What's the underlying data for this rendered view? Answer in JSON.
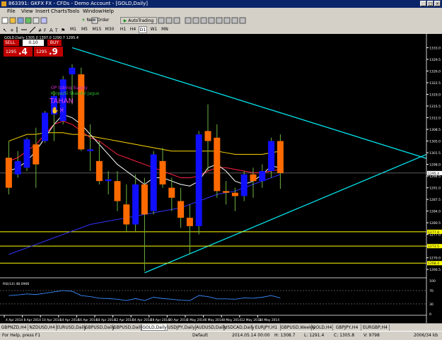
{
  "window": {
    "title": "863391: GKFX FX - CFDs - Demo Account - [GOLD,Daily]"
  },
  "menu": [
    "File",
    "View",
    "Insert",
    "Charts",
    "Tools",
    "Window",
    "Help"
  ],
  "toolbar": {
    "new_order": "New Order",
    "autotrading": "AutoTrading",
    "timeframes": [
      "M1",
      "M5",
      "M15",
      "M30",
      "H1",
      "H4",
      "D1",
      "W1",
      "MN"
    ]
  },
  "chart": {
    "header": "GOLD,Daily  1305.0 1307.0 1290.7 1295.4",
    "trade_panel": {
      "sell_label": "SELL",
      "buy_label": "BUY",
      "lot": "0.10",
      "sell_price_small": "1295",
      "sell_price_big": ".4",
      "buy_price_small": "1295",
      "buy_price_big": ".9"
    },
    "annotation": {
      "line1": "OP tubing Supply",
      "line2": "Ko/pa/Si Skandal Jagus",
      "name": "TAHAN",
      "glyph": "✋♓"
    },
    "price_scale": [
      "1333.0",
      "1329.5",
      "1326.0",
      "1322.5",
      "1319.0",
      "1315.5",
      "1312.0",
      "1308.5",
      "1305.0",
      "1301.5",
      "1298.0",
      "1294.5",
      "1291.0",
      "1287.5",
      "1284.0",
      "1280.5",
      "1277.0",
      "1273.5",
      "1270.0",
      "1266.5"
    ],
    "price_tags": [
      {
        "label": "1295.4",
        "color": "#ffffff",
        "text_color": "#000000"
      },
      {
        "label": "1277.8",
        "color": "#ffff00",
        "text_color": "#000000"
      },
      {
        "label": "1273.5",
        "color": "#ffff00",
        "text_color": "#000000"
      },
      {
        "label": "1268.4",
        "color": "#ffff00",
        "text_color": "#000000"
      }
    ],
    "date_axis": [
      "4 Apr 2014",
      "8 Apr 2014",
      "10 Apr 2014",
      "14 Apr 2014",
      "16 Apr 2014",
      "18 Apr 2014",
      "22 Apr 2014",
      "24 Apr 2014",
      "28 Apr 2014",
      "30 Apr 2014",
      "2 May 2014",
      "6 May 2014",
      "8 May 2014",
      "12 May 2014",
      "14 May 2014"
    ],
    "rsi_label": "RSI(14) 48.0906",
    "rsi_scale": [
      "100",
      "70",
      "30",
      "0"
    ],
    "colors": {
      "bull": "#1010ff",
      "bear": "#ff6a00",
      "wick": "#6db33f",
      "trend": "#00e5ee",
      "ma_red": "#ff2040",
      "ma_yellow": "#ffd700",
      "ma_white": "#ffffff",
      "ma_blue": "#3333ff",
      "level": "#ffff00"
    }
  },
  "chart_data": {
    "type": "candlestick",
    "symbol": "GOLD",
    "timeframe": "Daily",
    "candles": [
      {
        "o": 1300.0,
        "h": 1305.0,
        "l": 1289.0,
        "c": 1291.0
      },
      {
        "o": 1295.0,
        "h": 1302.0,
        "l": 1294.0,
        "c": 1299.0
      },
      {
        "o": 1297.0,
        "h": 1306.0,
        "l": 1296.0,
        "c": 1305.5
      },
      {
        "o": 1304.0,
        "h": 1309.0,
        "l": 1291.0,
        "c": 1298.0
      },
      {
        "o": 1305.0,
        "h": 1314.0,
        "l": 1304.5,
        "c": 1313.5
      },
      {
        "o": 1313.0,
        "h": 1320.0,
        "l": 1305.0,
        "c": 1318.5
      },
      {
        "o": 1311.0,
        "h": 1324.5,
        "l": 1310.0,
        "c": 1323.5
      },
      {
        "o": 1325.0,
        "h": 1328.0,
        "l": 1316.0,
        "c": 1327.0
      },
      {
        "o": 1325.0,
        "h": 1327.0,
        "l": 1302.0,
        "c": 1302.5
      },
      {
        "o": 1302.0,
        "h": 1310.0,
        "l": 1296.0,
        "c": 1302.5
      },
      {
        "o": 1299.0,
        "h": 1305.0,
        "l": 1292.0,
        "c": 1293.0
      },
      {
        "o": 1293.0,
        "h": 1296.0,
        "l": 1289.0,
        "c": 1293.5
      },
      {
        "o": 1293.0,
        "h": 1296.0,
        "l": 1284.0,
        "c": 1287.0
      },
      {
        "o": 1286.0,
        "h": 1292.0,
        "l": 1278.0,
        "c": 1280.0
      },
      {
        "o": 1280.0,
        "h": 1295.0,
        "l": 1278.0,
        "c": 1292.0
      },
      {
        "o": 1292.0,
        "h": 1294.0,
        "l": 1266.0,
        "c": 1283.0
      },
      {
        "o": 1284.0,
        "h": 1302.0,
        "l": 1283.0,
        "c": 1301.0
      },
      {
        "o": 1299.0,
        "h": 1303.0,
        "l": 1291.0,
        "c": 1292.0
      },
      {
        "o": 1291.0,
        "h": 1294.0,
        "l": 1284.0,
        "c": 1288.0
      },
      {
        "o": 1287.0,
        "h": 1291.0,
        "l": 1279.0,
        "c": 1282.0
      },
      {
        "o": 1282.0,
        "h": 1286.0,
        "l": 1271.0,
        "c": 1279.5
      },
      {
        "o": 1279.5,
        "h": 1308.0,
        "l": 1277.0,
        "c": 1307.0
      },
      {
        "o": 1308.0,
        "h": 1316.0,
        "l": 1296.0,
        "c": 1305.0
      },
      {
        "o": 1306.0,
        "h": 1310.0,
        "l": 1288.0,
        "c": 1290.0
      },
      {
        "o": 1290.0,
        "h": 1293.0,
        "l": 1286.0,
        "c": 1289.5
      },
      {
        "o": 1289.5,
        "h": 1291.0,
        "l": 1284.0,
        "c": 1288.5
      },
      {
        "o": 1288.5,
        "h": 1296.0,
        "l": 1287.0,
        "c": 1295.0
      },
      {
        "o": 1295.0,
        "h": 1297.0,
        "l": 1288.0,
        "c": 1293.0
      },
      {
        "o": 1293.0,
        "h": 1298.0,
        "l": 1291.0,
        "c": 1296.0
      },
      {
        "o": 1296.0,
        "h": 1306.0,
        "l": 1294.0,
        "c": 1305.0
      },
      {
        "o": 1305.0,
        "h": 1307.0,
        "l": 1290.7,
        "c": 1295.4
      }
    ],
    "ma_red": [
      1299,
      1300,
      1302,
      1304,
      1307,
      1310,
      1311,
      1310,
      1308,
      1306,
      1305,
      1303,
      1301,
      1300,
      1299,
      1298,
      1297,
      1296,
      1295,
      1294,
      1294,
      1294.5,
      1296,
      1297,
      1297,
      1296.5,
      1296,
      1295.5,
      1295.5,
      1296,
      1296.5
    ],
    "ma_yellow": [
      1305,
      1306,
      1307,
      1307,
      1307.5,
      1307.5,
      1307.5,
      1307,
      1307,
      1306.5,
      1306,
      1305.5,
      1305,
      1304.5,
      1304,
      1303.5,
      1303,
      1302.5,
      1302,
      1302,
      1302,
      1302,
      1302,
      1302,
      1301.5,
      1301,
      1301,
      1301,
      1301,
      1301.5,
      1302
    ],
    "ma_white": [
      1296,
      1297,
      1299,
      1302,
      1306,
      1310,
      1313,
      1312,
      1310,
      1307,
      1304,
      1301,
      1298,
      1296,
      1294,
      1292,
      1294,
      1294,
      1293,
      1292,
      1291.5,
      1293,
      1297,
      1298,
      1296,
      1293,
      1292,
      1293,
      1295,
      1297.5,
      1297
    ],
    "ma_blue": [
      1271,
      1272,
      1273,
      1274,
      1275,
      1276,
      1277,
      1278,
      1279,
      1280,
      1280.5,
      1281,
      1281.5,
      1282,
      1282.5,
      1283,
      1283.5,
      1284,
      1284.5,
      1285,
      1286,
      1287,
      1288,
      1289,
      1289.5,
      1290,
      1291,
      1292,
      1293,
      1294,
      1295
    ],
    "trend_upper": [
      {
        "i": 7,
        "p": 1333.0
      },
      {
        "i": 40,
        "p": 1305.0
      }
    ],
    "trend_lower": [
      {
        "i": 15,
        "p": 1265.5
      },
      {
        "i": 40,
        "p": 1294.0
      }
    ],
    "levels": [
      1277.8,
      1273.5,
      1268.4
    ],
    "current_price": 1295.4,
    "rsi": [
      55,
      57,
      60,
      58,
      62,
      66,
      70,
      68,
      55,
      52,
      47,
      46,
      44,
      40,
      46,
      40,
      50,
      46,
      44,
      41,
      40,
      55,
      52,
      45,
      45,
      44,
      48,
      47,
      50,
      55,
      48.09
    ],
    "ylim": [
      1264,
      1335
    ]
  }
}
